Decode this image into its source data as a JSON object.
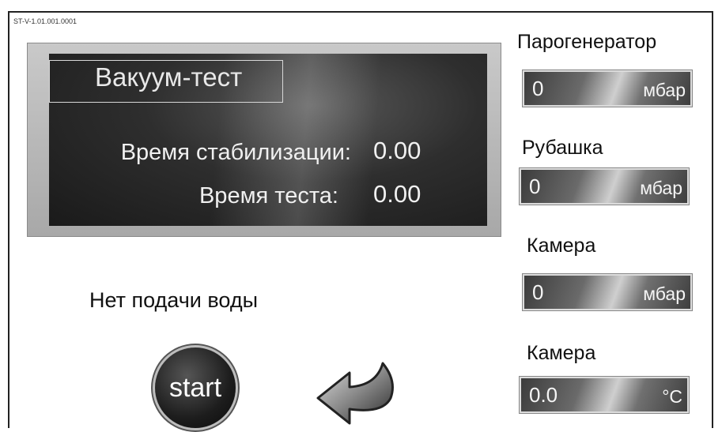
{
  "screen_id": "ST-V-1.01.001.0001",
  "vacuum_panel": {
    "title": "Вакуум-тест",
    "stabilization_label": "Время стабилизации:",
    "stabilization_value": "0.00",
    "test_label": "Время теста:",
    "test_value": "0.00"
  },
  "status": {
    "message": "Нет подачи воды"
  },
  "controls": {
    "start_label": "start",
    "back_icon": "back-arrow-icon"
  },
  "gauges": [
    {
      "label": "Парогенератор",
      "value": "0",
      "unit": "мбар"
    },
    {
      "label": "Рубашка",
      "value": "0",
      "unit": "мбар"
    },
    {
      "label": "Камера",
      "value": "0",
      "unit": "мбар"
    },
    {
      "label": "Камера",
      "value": "0.0",
      "unit": "°C"
    }
  ]
}
